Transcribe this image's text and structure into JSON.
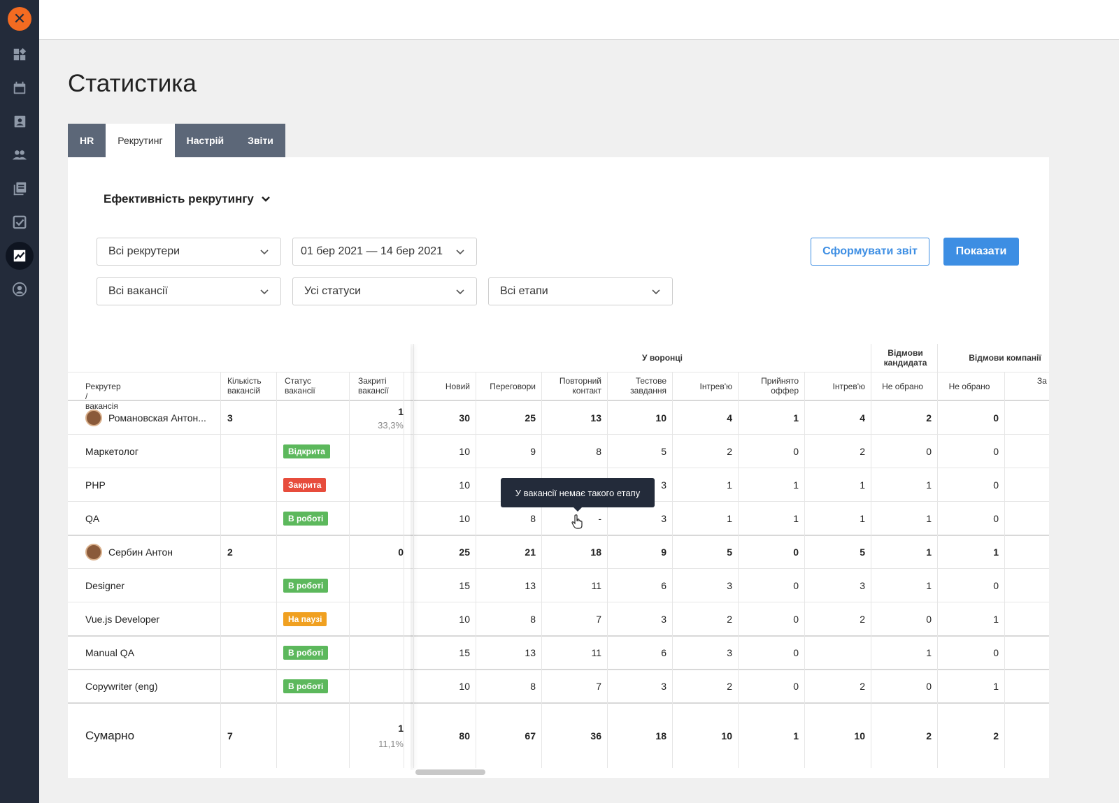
{
  "page": {
    "title": "Статистика"
  },
  "tabs": [
    {
      "label": "HR",
      "active": false
    },
    {
      "label": "Рекрутинг",
      "active": true
    },
    {
      "label": "Настрій",
      "active": false
    },
    {
      "label": "Звіти",
      "active": false
    }
  ],
  "report": {
    "selected": "Ефективність рекрутингу"
  },
  "filters": {
    "recruiters": "Всі рекрутери",
    "dates": "01 бер 2021 — 14 бер 2021",
    "vacancies": "Всі вакансії",
    "statuses": "Усі статуси",
    "stages": "Всі етапи"
  },
  "buttons": {
    "report": "Сформувати звіт",
    "show": "Показати"
  },
  "table": {
    "groups": {
      "funnel": "У воронці",
      "candidate_refusals": "Відмови кандидата",
      "company_refusals": "Відмови компанії"
    },
    "headers": {
      "recruiter": "Рекрутер / вакансія",
      "count": "Кількість вакансій",
      "status": "Статус вакансії",
      "closed": "Закриті вакансії",
      "new": "Новий",
      "talks": "Переговори",
      "repeat": "Повторний контакт",
      "test": "Тестове завдання",
      "interview1": "Інтрев'ю",
      "offer": "Прийнято оффер",
      "interview2": "Інтрев'ю",
      "cand_not_chosen": "Не обрано",
      "comp_not_chosen": "Не обрано",
      "comp_initiative": "За ініц"
    },
    "rows": [
      {
        "name": "Романовская Антон...",
        "count": "3",
        "closed": "1",
        "closed_pct": "33,3%",
        "values": [
          "30",
          "25",
          "13",
          "10",
          "4",
          "1",
          "4",
          "2",
          "0"
        ]
      },
      {
        "name": "Маркетолог",
        "status": "Відкрита",
        "values": [
          "10",
          "9",
          "8",
          "5",
          "2",
          "0",
          "2",
          "0",
          "0"
        ]
      },
      {
        "name": "PHP",
        "status": "Закрита",
        "values": [
          "10",
          "",
          "",
          "3",
          "1",
          "1",
          "1",
          "1",
          "0"
        ]
      },
      {
        "name": "QA",
        "status": "В роботі",
        "values": [
          "10",
          "8",
          "-",
          "3",
          "1",
          "1",
          "1",
          "1",
          "0"
        ]
      },
      {
        "name": "Сербин Антон",
        "count": "2",
        "closed": "0",
        "values": [
          "25",
          "21",
          "18",
          "9",
          "5",
          "0",
          "5",
          "1",
          "1"
        ]
      },
      {
        "name": "Designer",
        "status": "В роботі",
        "values": [
          "15",
          "13",
          "11",
          "6",
          "3",
          "0",
          "3",
          "1",
          "0"
        ]
      },
      {
        "name": "Vue.js Developer",
        "status": "На паузі",
        "values": [
          "10",
          "8",
          "7",
          "3",
          "2",
          "0",
          "2",
          "0",
          "1"
        ]
      },
      {
        "name": "Manual QA",
        "status": "В роботі",
        "values": [
          "15",
          "13",
          "11",
          "6",
          "3",
          "0",
          "",
          "1",
          "0"
        ]
      },
      {
        "name": "Copywriter (eng)",
        "status": "В роботі",
        "values": [
          "10",
          "8",
          "7",
          "3",
          "2",
          "0",
          "2",
          "0",
          "1"
        ]
      }
    ],
    "total": {
      "label": "Сумарно",
      "count": "7",
      "closed": "1",
      "closed_pct": "11,1%",
      "values": [
        "80",
        "67",
        "36",
        "18",
        "10",
        "1",
        "10",
        "2",
        "2"
      ]
    }
  },
  "tooltip": {
    "text": "У вакансії немає такого етапу"
  },
  "colors": {
    "open": "#5cb85c",
    "closed": "#e74c3c",
    "in_work": "#5cb85c",
    "paused": "#f0a020",
    "accent": "#3d8ee3",
    "sidebar": "#232b3a",
    "logo": "#f36b21"
  }
}
